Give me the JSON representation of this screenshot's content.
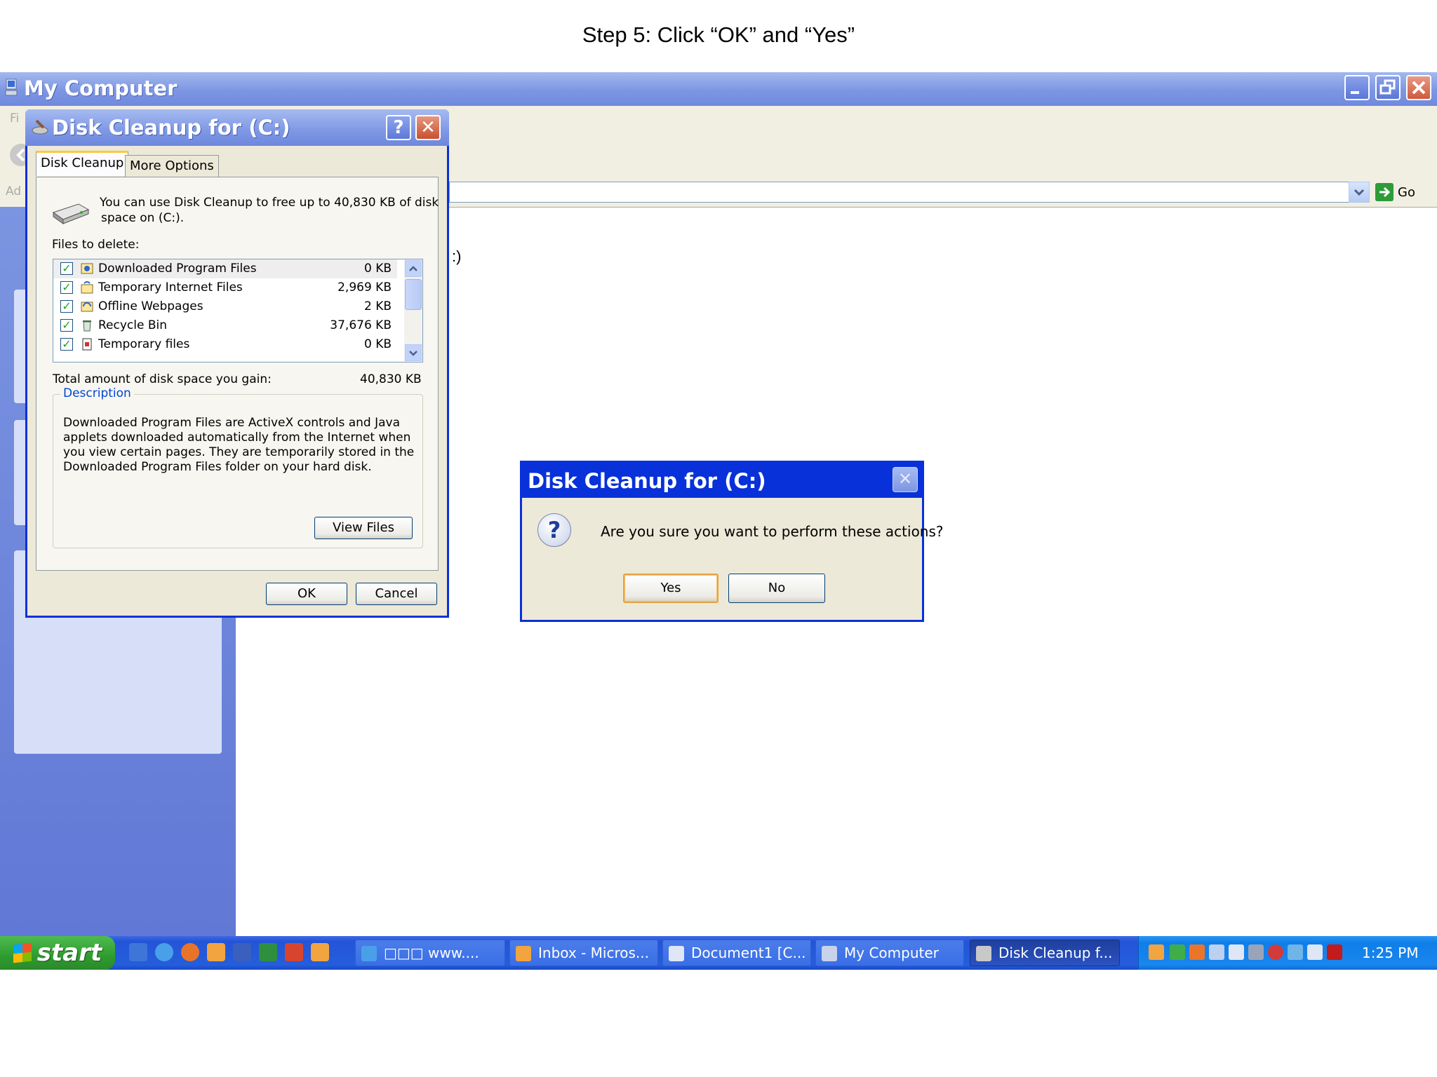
{
  "caption": "Step 5: Click “OK” and “Yes”",
  "my_computer": {
    "title": "My Computer",
    "menu_partial": "Fi",
    "address_partial": "Ad",
    "drive_label_partial": ":)",
    "go_label": "Go"
  },
  "disk_cleanup": {
    "title": "Disk Cleanup for  (C:)",
    "help_glyph": "?",
    "close_glyph": "✕",
    "tabs": [
      "Disk Cleanup",
      "More Options"
    ],
    "intro_line1": "You can use Disk Cleanup to free up to 40,830 KB of disk",
    "intro_line2": "space on  (C:).",
    "files_label": "Files to delete:",
    "files": [
      {
        "name": "Downloaded Program Files",
        "size": "0 KB",
        "checked": true
      },
      {
        "name": "Temporary Internet Files",
        "size": "2,969 KB",
        "checked": true
      },
      {
        "name": "Offline Webpages",
        "size": "2 KB",
        "checked": true
      },
      {
        "name": "Recycle Bin",
        "size": "37,676 KB",
        "checked": true
      },
      {
        "name": "Temporary files",
        "size": "0 KB",
        "checked": true
      }
    ],
    "total_label": "Total amount of disk space you gain:",
    "total_value": "40,830 KB",
    "description_label": "Description",
    "description_text": "Downloaded Program Files are ActiveX controls and Java applets downloaded automatically from the Internet when you view certain pages. They are temporarily stored in the Downloaded Program Files folder on your hard disk.",
    "view_files_label": "View Files",
    "ok_label": "OK",
    "cancel_label": "Cancel"
  },
  "confirm": {
    "title": "Disk Cleanup for  (C:)",
    "close_glyph": "✕",
    "message": "Are you sure you want to perform these actions?",
    "yes_label": "Yes",
    "no_label": "No"
  },
  "taskbar": {
    "start_label": "start",
    "tasks": [
      "□□□ www....",
      "Inbox - Micros...",
      "Document1 [C...",
      "My Computer",
      "Disk Cleanup f..."
    ],
    "clock": "1:25 PM"
  },
  "colors": {
    "title_active": "#0831d9",
    "taskbar": "#245edb",
    "tray": "#0f7ee8",
    "start": "#2e9c2e",
    "dialog_bg": "#ece9d8"
  }
}
